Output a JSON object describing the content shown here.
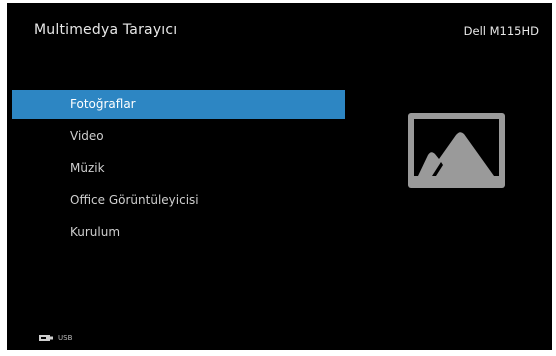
{
  "header": {
    "title": "Multimedya Tarayıcı",
    "device": "Dell M115HD"
  },
  "menu": {
    "selected_index": 0,
    "items": [
      {
        "label": "Fotoğraflar"
      },
      {
        "label": "Video"
      },
      {
        "label": "Müzik"
      },
      {
        "label": "Office Görüntüleyicisi"
      },
      {
        "label": "Kurulum"
      }
    ]
  },
  "preview": {
    "icon": "photo-mountain-icon"
  },
  "status": {
    "source_icon": "usb-icon",
    "source_label": "USB"
  },
  "colors": {
    "background": "#000000",
    "highlight": "#2d86c3",
    "text": "#e6e6e6",
    "icon_gray": "#9a9a9a"
  }
}
